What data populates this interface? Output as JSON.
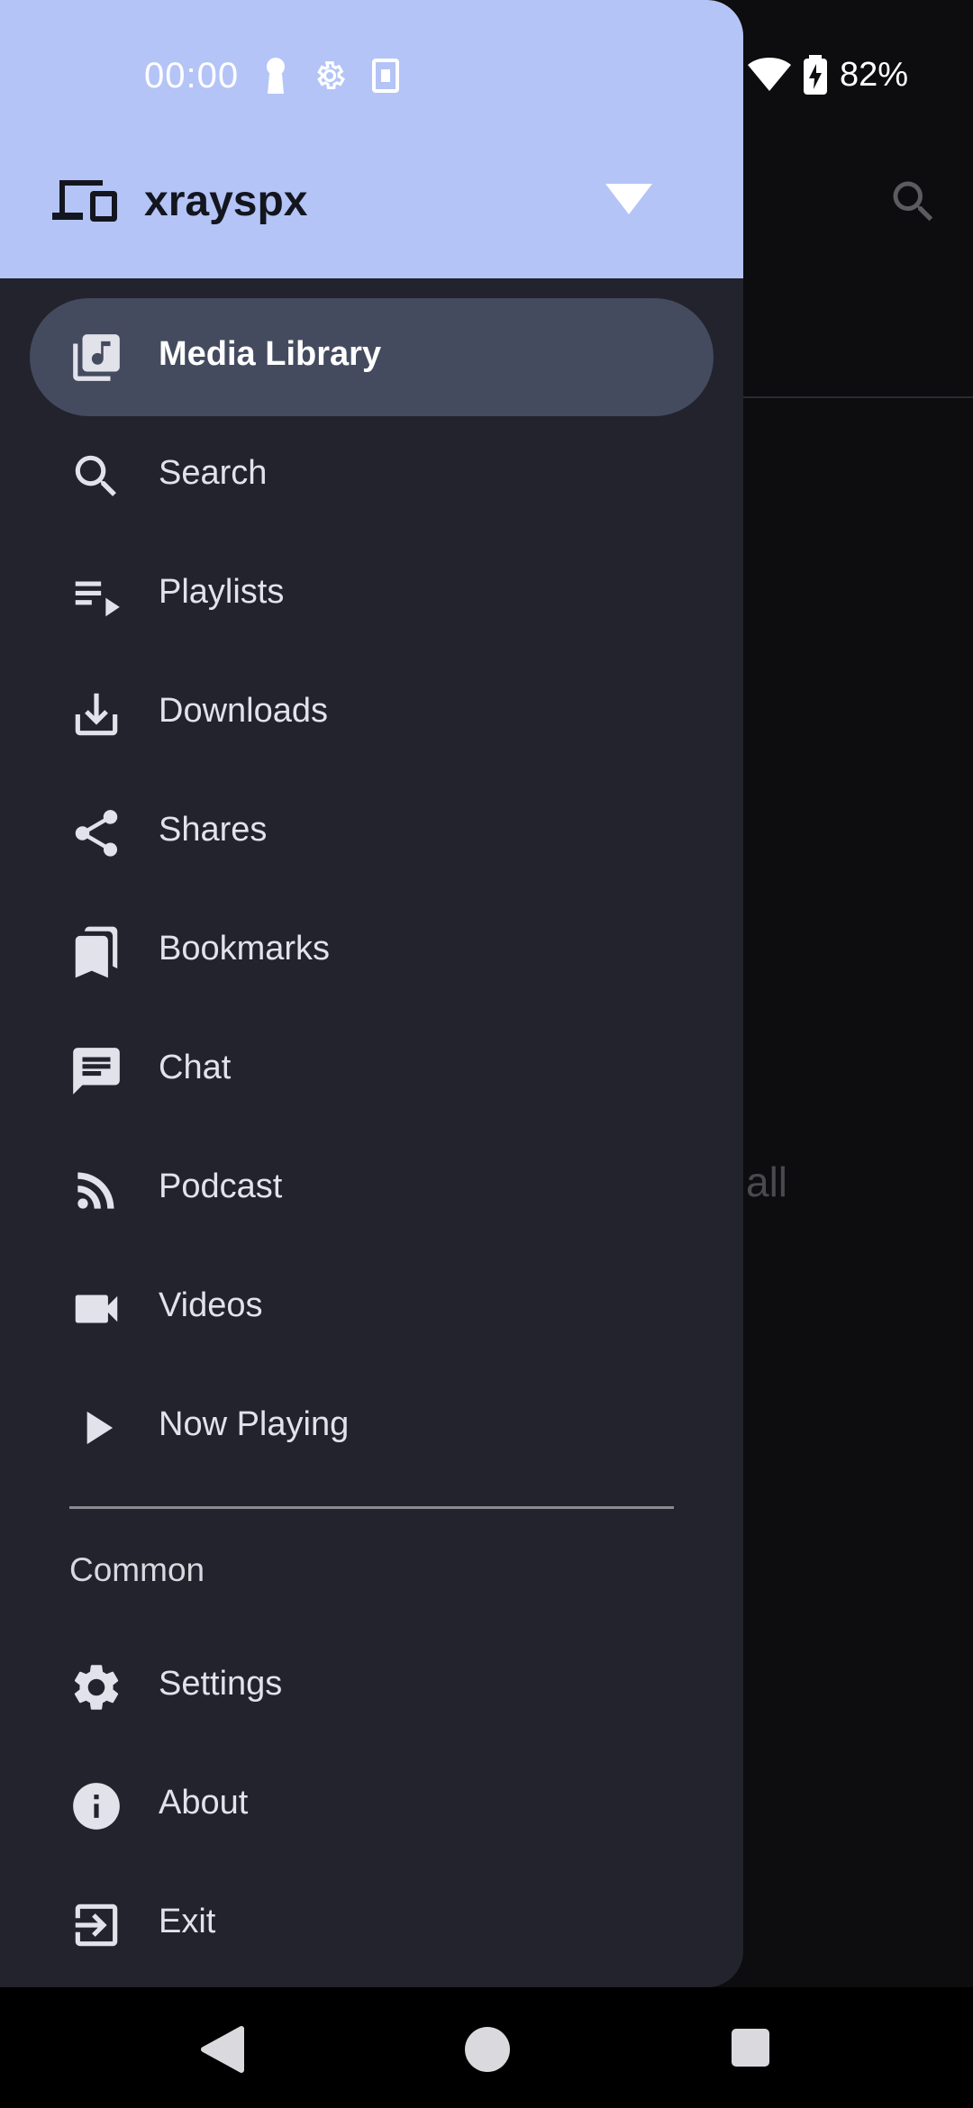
{
  "status_bar": {
    "time": "00:00",
    "battery_percent": "82%",
    "icons": [
      "key-icon",
      "settings-gear-icon",
      "sim-card-icon",
      "wifi-icon",
      "battery-charging-icon"
    ]
  },
  "account": {
    "name": "xrayspx",
    "icon": "devices-icon",
    "expand_icon": "dropdown-arrow-icon"
  },
  "menu": {
    "items": [
      {
        "label": "Media Library",
        "icon": "library-music-icon",
        "active": true
      },
      {
        "label": "Search",
        "icon": "search-icon"
      },
      {
        "label": "Playlists",
        "icon": "playlist-play-icon"
      },
      {
        "label": "Downloads",
        "icon": "download-icon"
      },
      {
        "label": "Shares",
        "icon": "share-icon"
      },
      {
        "label": "Bookmarks",
        "icon": "bookmarks-icon"
      },
      {
        "label": "Chat",
        "icon": "chat-icon"
      },
      {
        "label": "Podcast",
        "icon": "rss-feed-icon"
      },
      {
        "label": "Videos",
        "icon": "videocam-icon"
      },
      {
        "label": "Now Playing",
        "icon": "play-arrow-icon"
      }
    ]
  },
  "common": {
    "title": "Common",
    "items": [
      {
        "label": "Settings",
        "icon": "settings-icon"
      },
      {
        "label": "About",
        "icon": "info-icon"
      },
      {
        "label": "Exit",
        "icon": "exit-icon"
      }
    ]
  },
  "background": {
    "partial_text": "all",
    "search_icon": "search-icon"
  },
  "colors": {
    "drawer_bg": "#22232c",
    "header_bg": "#b4c4f7",
    "active_pill": "#444b5f",
    "text": "#e2e2ea"
  }
}
